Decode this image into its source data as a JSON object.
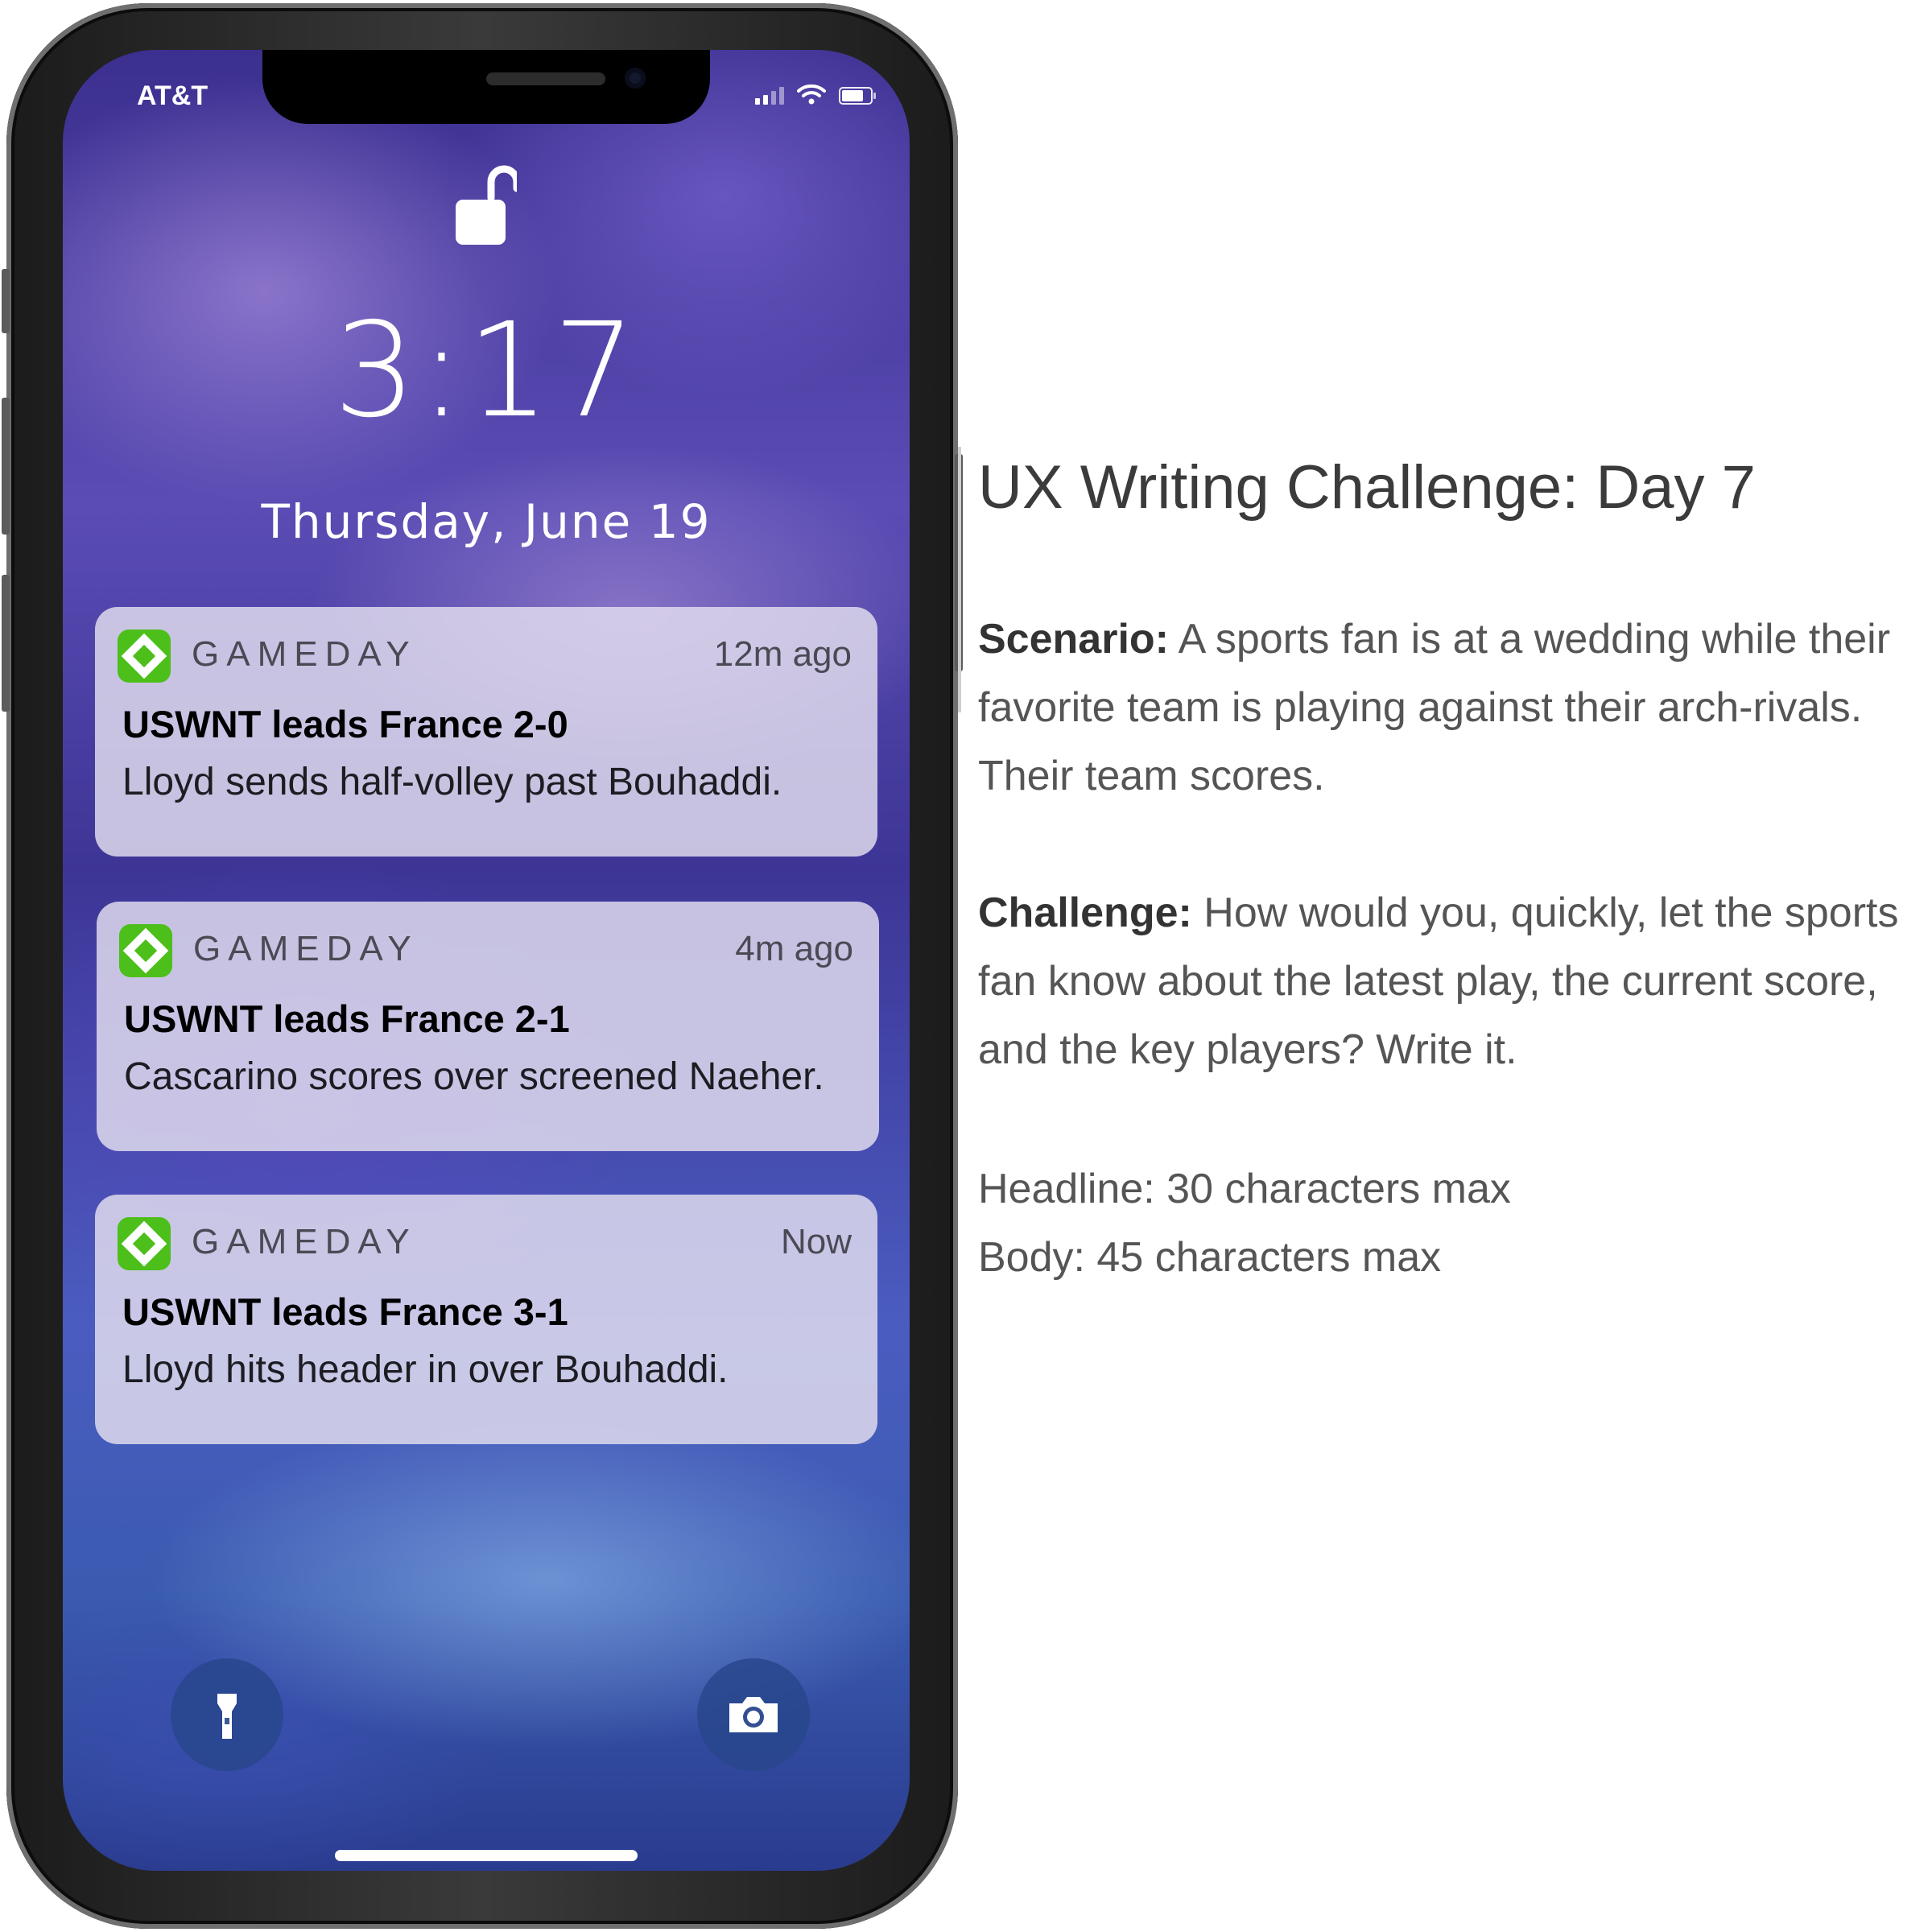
{
  "status_bar": {
    "carrier": "AT&T"
  },
  "lock_screen": {
    "time": "3:17",
    "date": "Thursday, June 19"
  },
  "notifications": [
    {
      "app": "GAMEDAY",
      "age": "12m ago",
      "headline": "USWNT leads France 2-0",
      "body": "Lloyd sends half-volley past Bouhaddi."
    },
    {
      "app": "GAMEDAY",
      "age": "4m ago",
      "headline": "USWNT leads France 2-1",
      "body": "Cascarino scores over screened Naeher."
    },
    {
      "app": "GAMEDAY",
      "age": "Now",
      "headline": "USWNT leads France 3-1",
      "body": "Lloyd hits header in over Bouhaddi."
    }
  ],
  "icons": {
    "lock": "unlocked-padlock-icon",
    "flashlight": "flashlight-icon",
    "camera": "camera-icon",
    "app": "gameday-diamond-icon"
  },
  "colors": {
    "app_icon": "#4cbf1a",
    "notification_bg": "#e1dcee"
  },
  "challenge": {
    "title": "UX Writing Challenge: Day 7",
    "scenario_label": "Scenario:",
    "scenario_lines": [
      " A sports fan is at a wedding while their",
      "favorite team is playing against their arch-rivals.",
      "Their team scores."
    ],
    "challenge_label": "Challenge:",
    "challenge_lines": [
      " How would you, quickly, let the sports",
      "fan know about the latest play, the current score,",
      "and the key players? Write it."
    ],
    "headline_limit": "Headline: 30 characters max",
    "body_limit": "Body: 45 characters max"
  }
}
